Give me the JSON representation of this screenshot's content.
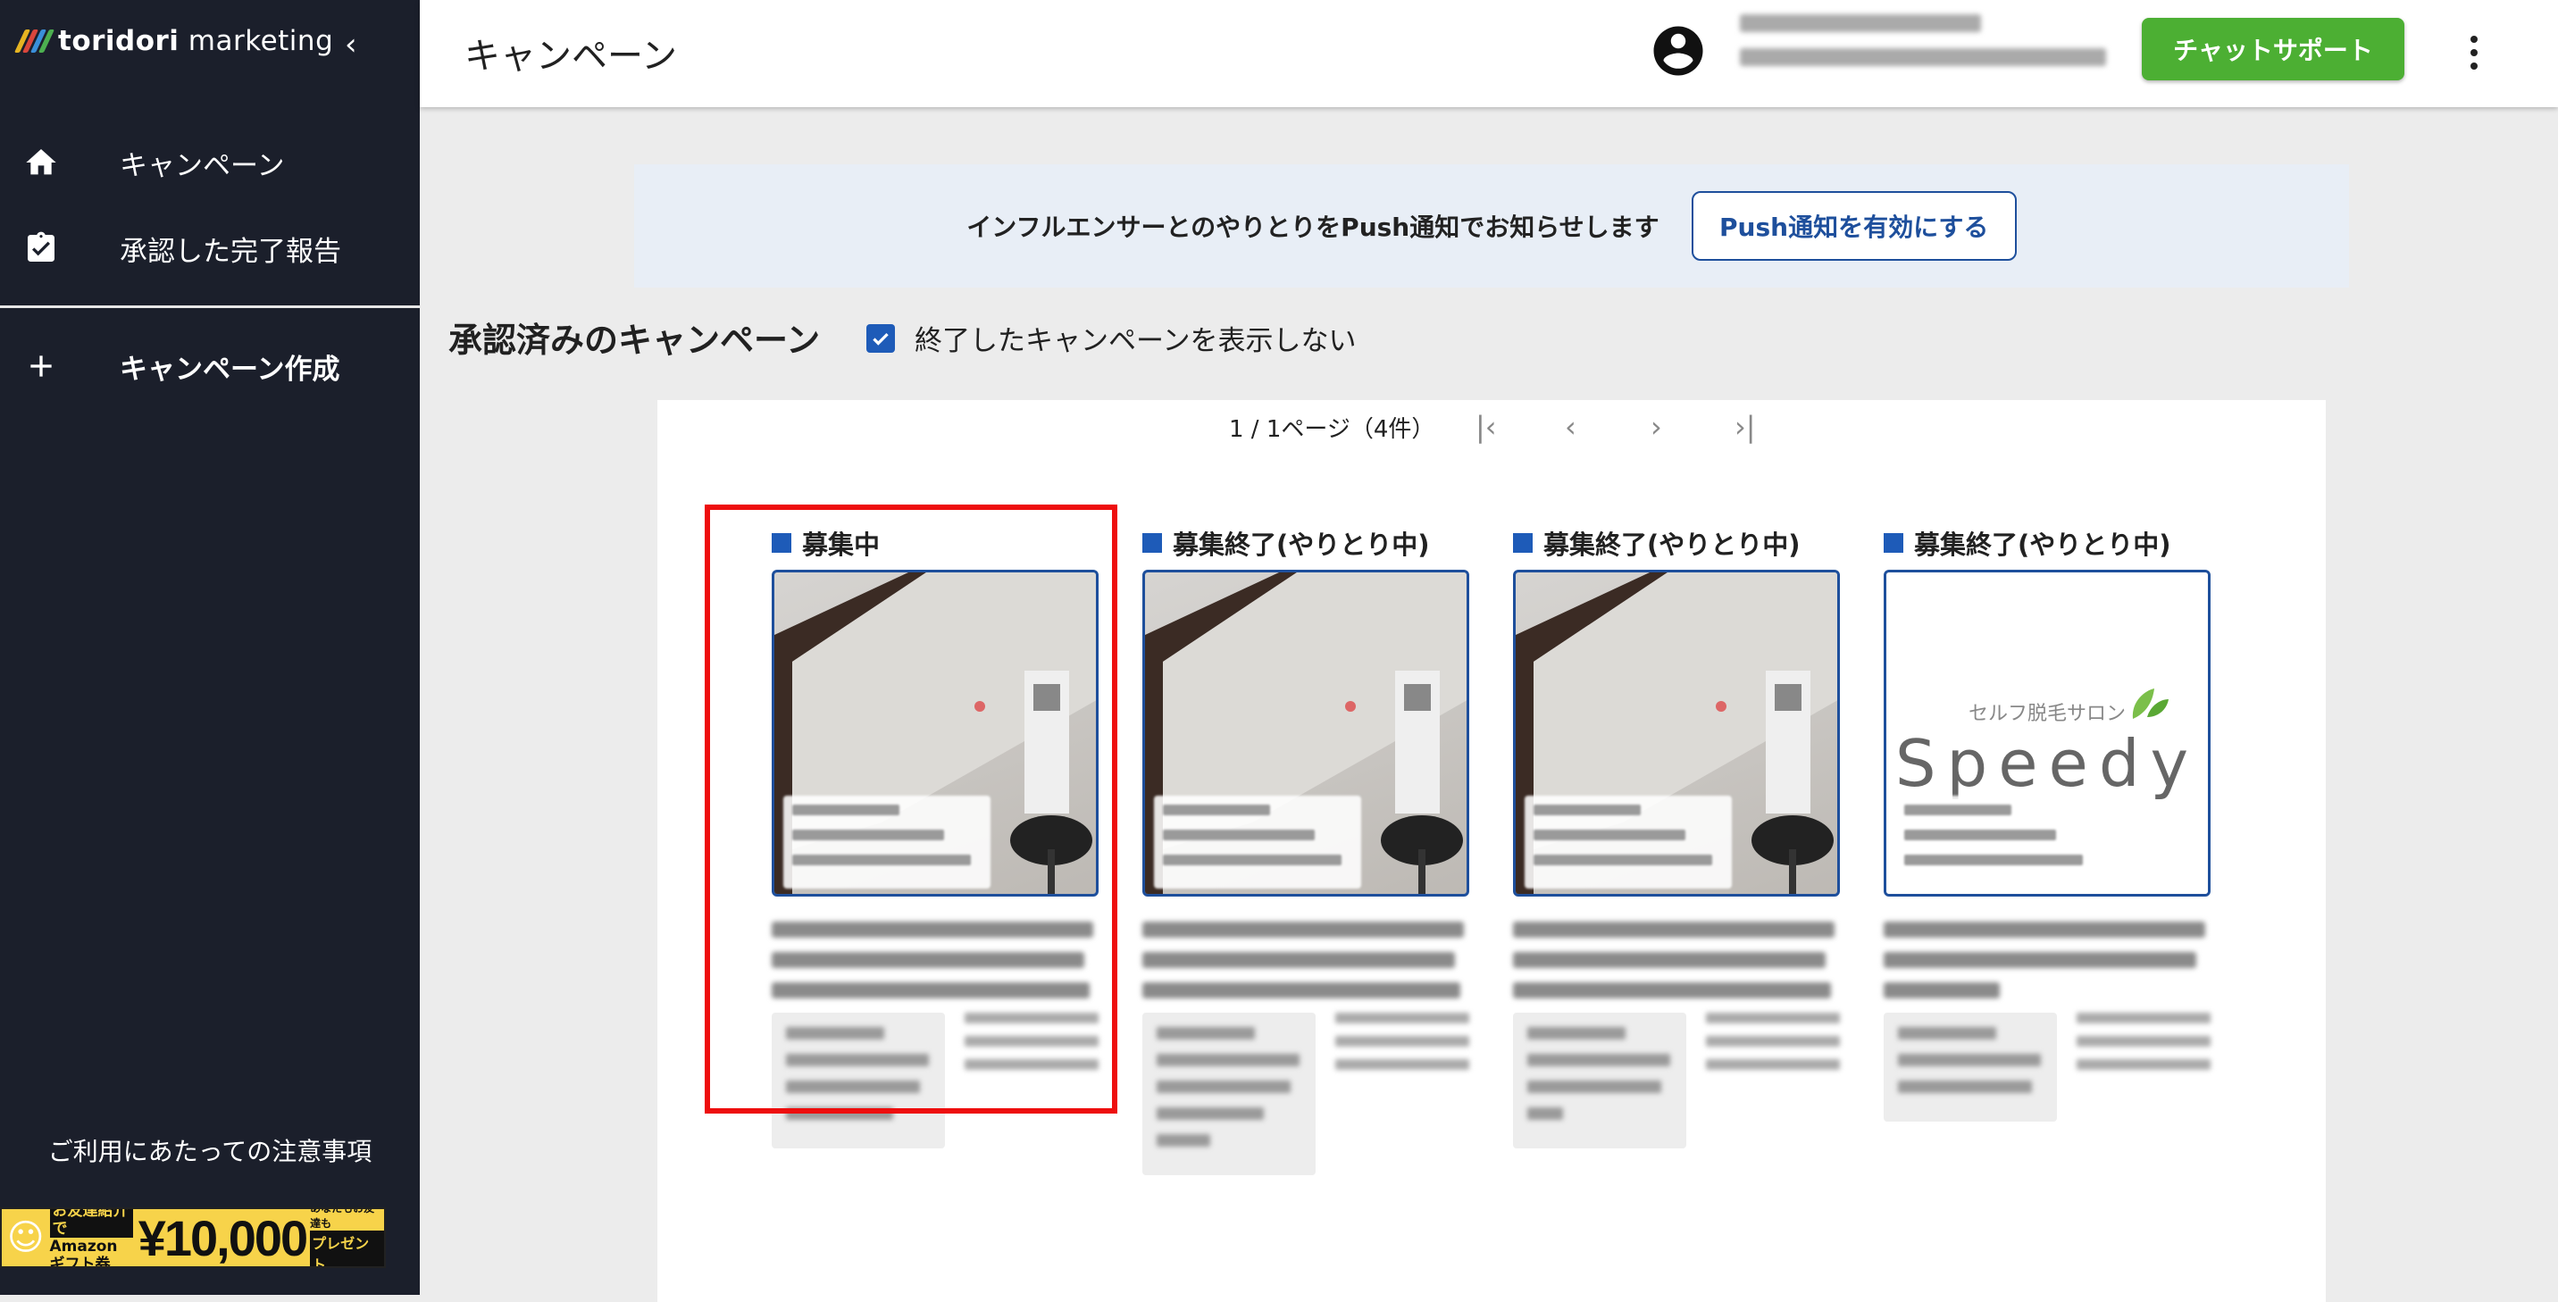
{
  "sidebar": {
    "logo": {
      "brand": "toridori",
      "product": "marketing"
    },
    "collapse_icon": "chevron-left-icon",
    "nav": [
      {
        "label": "キャンペーン",
        "icon": "home-icon"
      },
      {
        "label": "承認した完了報告",
        "icon": "clipboard-check-icon"
      }
    ],
    "create": {
      "label": "キャンペーン作成",
      "icon": "plus-icon"
    },
    "notes_link": "ご利用にあたっての注意事項",
    "promo_banner": {
      "line1": "お友達紹介で",
      "line2": "Amazon",
      "line3": "ギフト券",
      "amount": "¥10,000",
      "tag_top": "あなたもお友達も",
      "tag": "プレゼント"
    }
  },
  "header": {
    "title": "キャンペーン",
    "chat_button": "チャットサポート",
    "menu_icon": "more-vertical-icon",
    "account_icon": "account-circle-icon"
  },
  "push_notice": {
    "text": "インフルエンサーとのやりとりをPush通知でお知らせします",
    "button": "Push通知を有効にする"
  },
  "section": {
    "title": "承認済みのキャンペーン",
    "hide_ended_label": "終了したキャンペーンを表示しない",
    "hide_ended_checked": true
  },
  "pagination": {
    "text": "1 / 1ページ（4件）",
    "first_icon": "first-page-icon",
    "prev_icon": "chevron-left-icon",
    "next_icon": "chevron-right-icon",
    "last_icon": "last-page-icon"
  },
  "campaigns": [
    {
      "status": "募集中",
      "image": "salon-room-photo"
    },
    {
      "status": "募集終了(やりとり中)",
      "image": "salon-room-photo"
    },
    {
      "status": "募集終了(やりとり中)",
      "image": "salon-room-photo"
    },
    {
      "status": "募集終了(やりとり中)",
      "image": "speedy-logo",
      "logo_sub": "セルフ脱毛サロン",
      "logo_word": "Speedy"
    }
  ],
  "colors": {
    "sidebar_bg": "#1b1f2b",
    "chat_button": "#4caf33",
    "accent_blue": "#1e5bb8",
    "highlight_red": "#ee0e0e"
  }
}
